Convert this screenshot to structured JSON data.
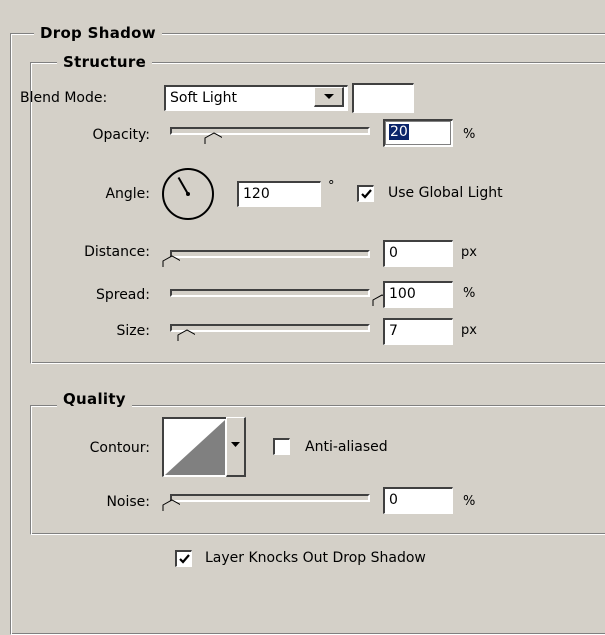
{
  "panel": {
    "title": "Drop Shadow"
  },
  "structure": {
    "title": "Structure",
    "blend_mode": {
      "label": "Blend Mode:",
      "value": "Soft Light",
      "swatch_color": "#ffffff"
    },
    "opacity": {
      "label": "Opacity:",
      "value": "20",
      "unit": "%",
      "level": 0.2
    },
    "angle": {
      "label": "Angle:",
      "value": "120",
      "unit": "°",
      "degrees": 120
    },
    "use_global_light": {
      "label": "Use Global Light",
      "checked": true
    },
    "distance": {
      "label": "Distance:",
      "value": "0",
      "unit": "px",
      "level": 0
    },
    "spread": {
      "label": "Spread:",
      "value": "100",
      "unit": "%",
      "level": 1
    },
    "size": {
      "label": "Size:",
      "value": "7",
      "unit": "px",
      "level": 0.07
    }
  },
  "quality": {
    "title": "Quality",
    "contour": {
      "label": "Contour:"
    },
    "anti_aliased": {
      "label": "Anti-aliased",
      "checked": false
    },
    "noise": {
      "label": "Noise:",
      "value": "0",
      "unit": "%",
      "level": 0
    }
  },
  "layer_knocks_out": {
    "label": "Layer Knocks Out Drop Shadow",
    "checked": true
  },
  "colors": {
    "face": "#d4d0c8",
    "selection": "#0a246a",
    "contour_fill": "#808080"
  }
}
